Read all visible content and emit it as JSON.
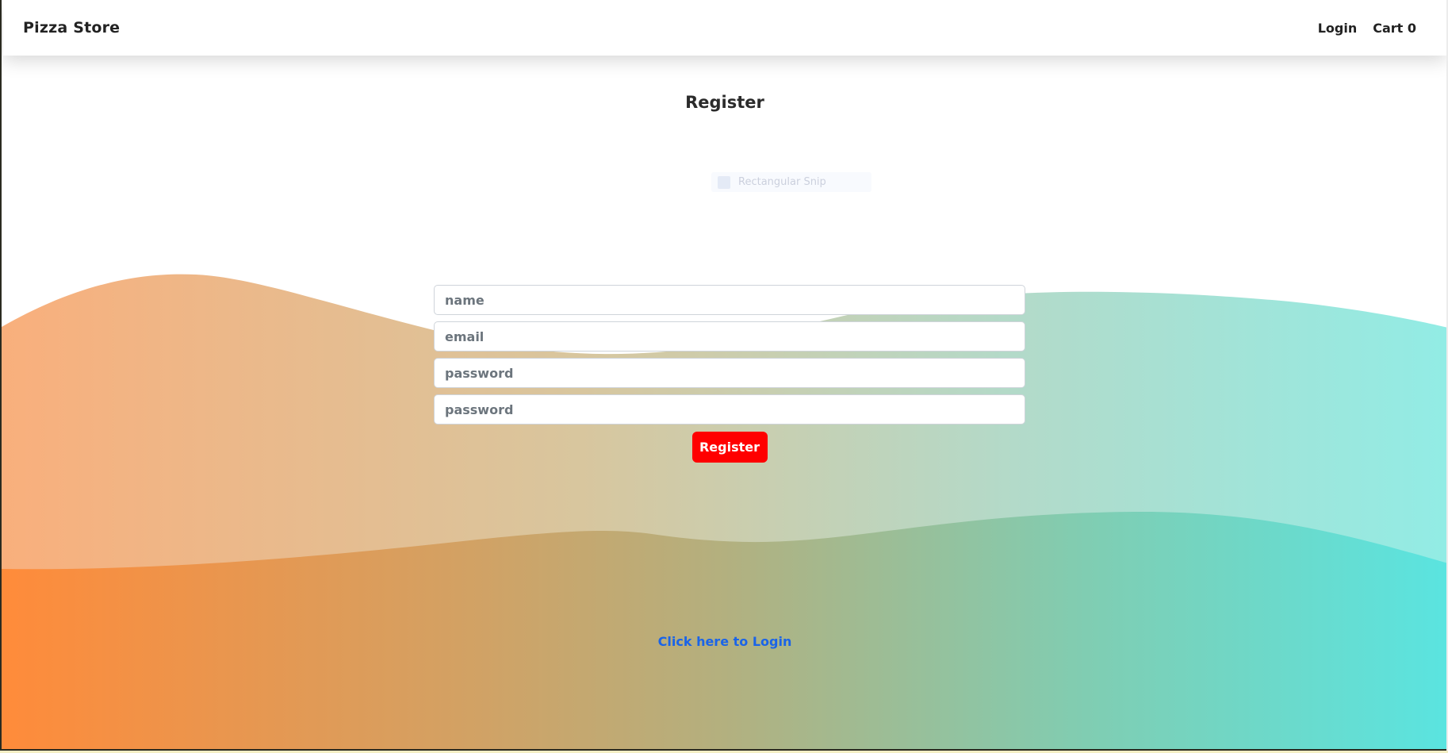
{
  "navbar": {
    "brand": "Pizza Store",
    "login_label": "Login",
    "cart_label": "Cart 0"
  },
  "page": {
    "title": "Register",
    "snip_label": "Rectangular Snip"
  },
  "form": {
    "name_placeholder": "name",
    "email_placeholder": "email",
    "password_placeholder": "password",
    "confirm_password_placeholder": "password",
    "submit_label": "Register"
  },
  "footer": {
    "login_link": "Click here to Login"
  },
  "colors": {
    "accent_button": "#ff0000",
    "link": "#1a64e8",
    "wave_left": "#ff8c3a",
    "wave_right": "#5ee3df"
  }
}
